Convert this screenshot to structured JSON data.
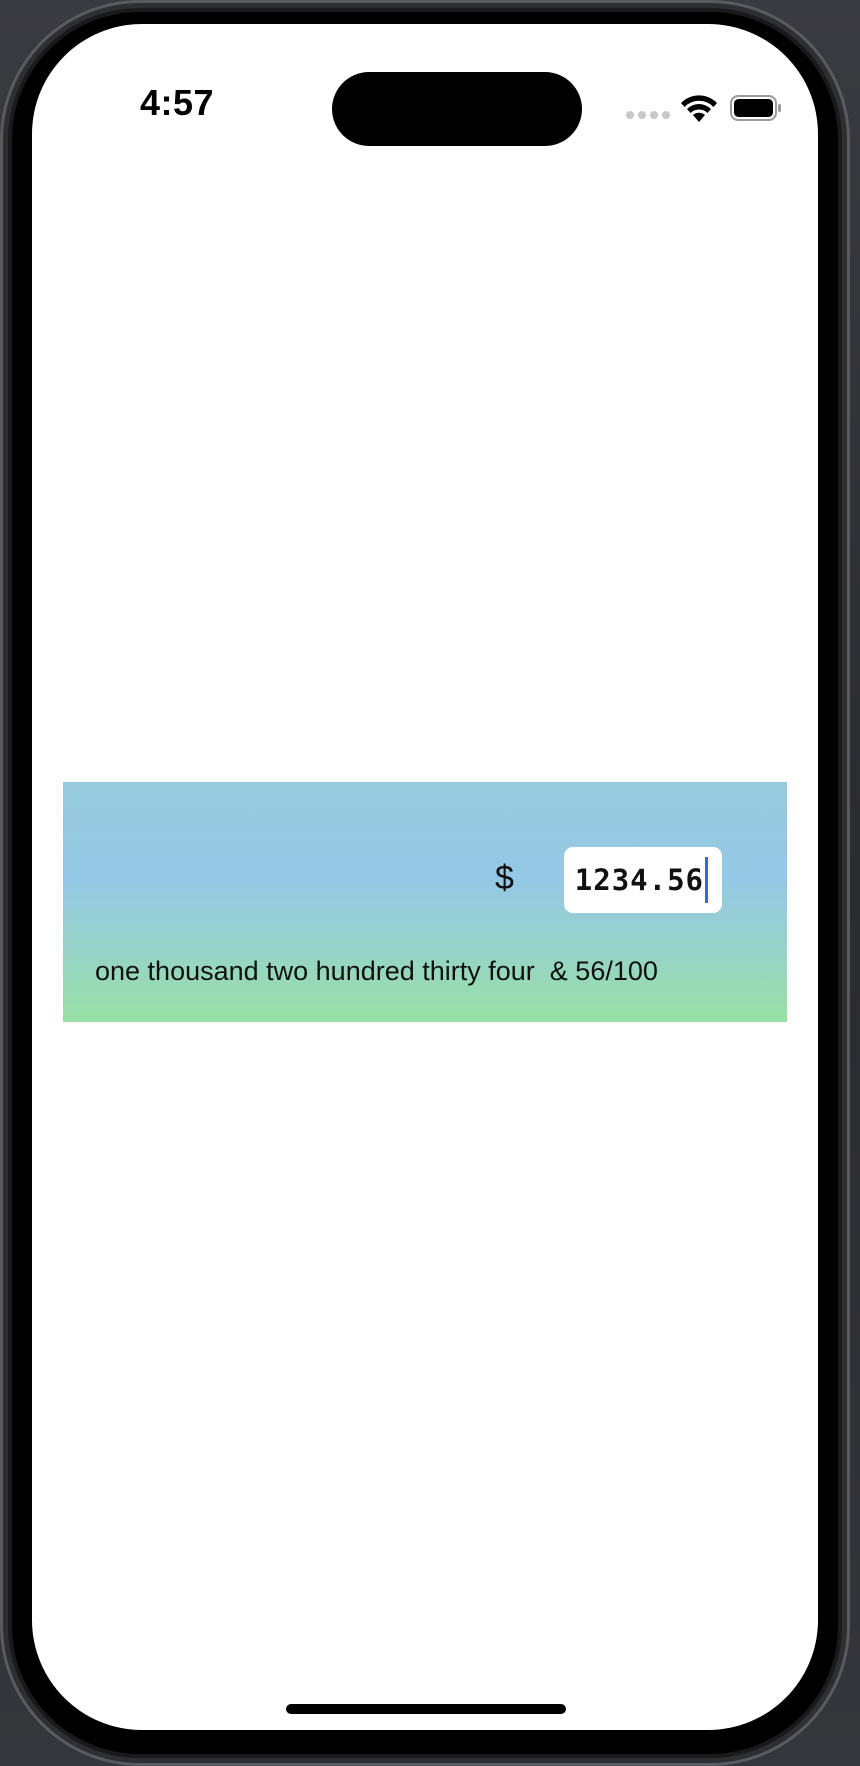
{
  "status_bar": {
    "time": "4:57",
    "icons": [
      "cellular-signal-icon",
      "wifi-icon",
      "battery-icon"
    ]
  },
  "check": {
    "currency_symbol": "$",
    "amount_value": "1234.56",
    "amount_in_words": "one thousand two hundred thirty four  & 56/100"
  },
  "colors": {
    "card_gradient_top": "#96cadc",
    "card_gradient_mid": "#95c8e6",
    "card_gradient_bottom": "#98e0a3",
    "caret": "#2d6fe0"
  }
}
